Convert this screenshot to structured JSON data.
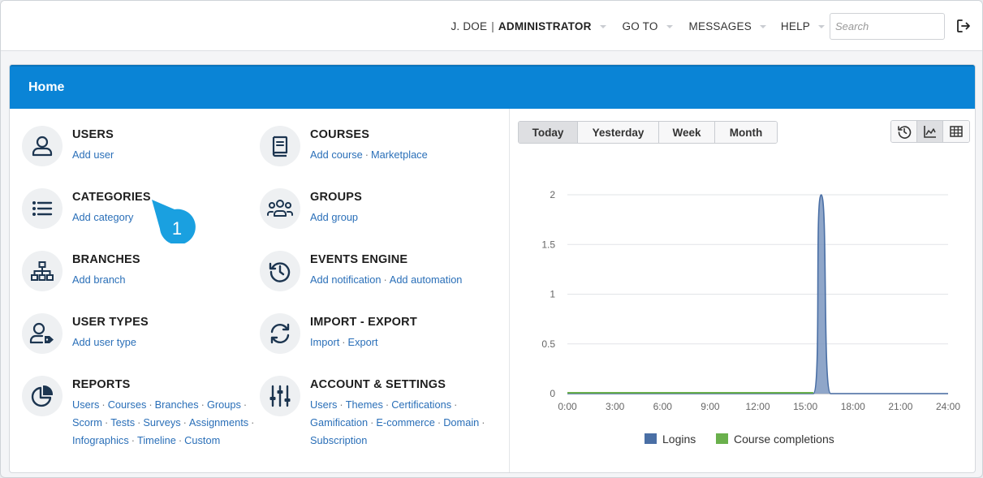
{
  "topbar": {
    "user_name": "J. DOE",
    "user_separator": "|",
    "user_role": "ADMINISTRATOR",
    "goto_label": "GO TO",
    "messages_label": "MESSAGES",
    "help_label": "HELP",
    "search_placeholder": "Search",
    "search_value": ""
  },
  "panel": {
    "title": "Home"
  },
  "tiles": {
    "users": {
      "title": "USERS",
      "links": [
        "Add user"
      ]
    },
    "courses": {
      "title": "COURSES",
      "links": [
        "Add course",
        "Marketplace"
      ]
    },
    "categories": {
      "title": "CATEGORIES",
      "links": [
        "Add category"
      ]
    },
    "groups": {
      "title": "GROUPS",
      "links": [
        "Add group"
      ]
    },
    "branches": {
      "title": "BRANCHES",
      "links": [
        "Add branch"
      ]
    },
    "events": {
      "title": "EVENTS ENGINE",
      "links": [
        "Add notification",
        "Add automation"
      ]
    },
    "usertypes": {
      "title": "USER TYPES",
      "links": [
        "Add user type"
      ]
    },
    "importexport": {
      "title": "IMPORT - EXPORT",
      "links": [
        "Import",
        "Export"
      ]
    },
    "reports": {
      "title": "REPORTS",
      "links": [
        "Users",
        "Courses",
        "Branches",
        "Groups",
        "Scorm",
        "Tests",
        "Surveys",
        "Assignments",
        "Infographics",
        "Timeline",
        "Custom"
      ]
    },
    "account": {
      "title": "ACCOUNT & SETTINGS",
      "links": [
        "Users",
        "Themes",
        "Certifications",
        "Gamification",
        "E-commerce",
        "Domain",
        "Subscription"
      ]
    }
  },
  "badge": {
    "number": "1",
    "color": "#1aa0e0"
  },
  "chart_controls": {
    "periods": [
      "Today",
      "Yesterday",
      "Week",
      "Month"
    ],
    "active_period": "Today",
    "views": [
      {
        "icon": "history-icon",
        "active": false
      },
      {
        "icon": "line-chart-icon",
        "active": true
      },
      {
        "icon": "table-grid-icon",
        "active": false
      }
    ]
  },
  "chart_data": {
    "type": "area",
    "x": [
      "0:00",
      "3:00",
      "6:00",
      "9:00",
      "12:00",
      "15:00",
      "18:00",
      "21:00",
      "24:00"
    ],
    "ylim": [
      0,
      2
    ],
    "yticks": [
      "0",
      "0.5",
      "1",
      "1.5",
      "2"
    ],
    "grid": true,
    "legend_position": "bottom",
    "series": [
      {
        "name": "Logins",
        "color": "#4a6fa5",
        "points": [
          [
            0,
            0
          ],
          [
            15,
            0
          ],
          [
            15.5,
            0
          ],
          [
            15.75,
            1.0
          ],
          [
            16,
            2
          ],
          [
            16.3,
            1.0
          ],
          [
            16.6,
            0
          ],
          [
            24,
            0
          ]
        ]
      },
      {
        "name": "Course completions",
        "color": "#6ab04c",
        "points": [
          [
            0,
            0
          ],
          [
            24,
            0
          ]
        ]
      }
    ]
  }
}
